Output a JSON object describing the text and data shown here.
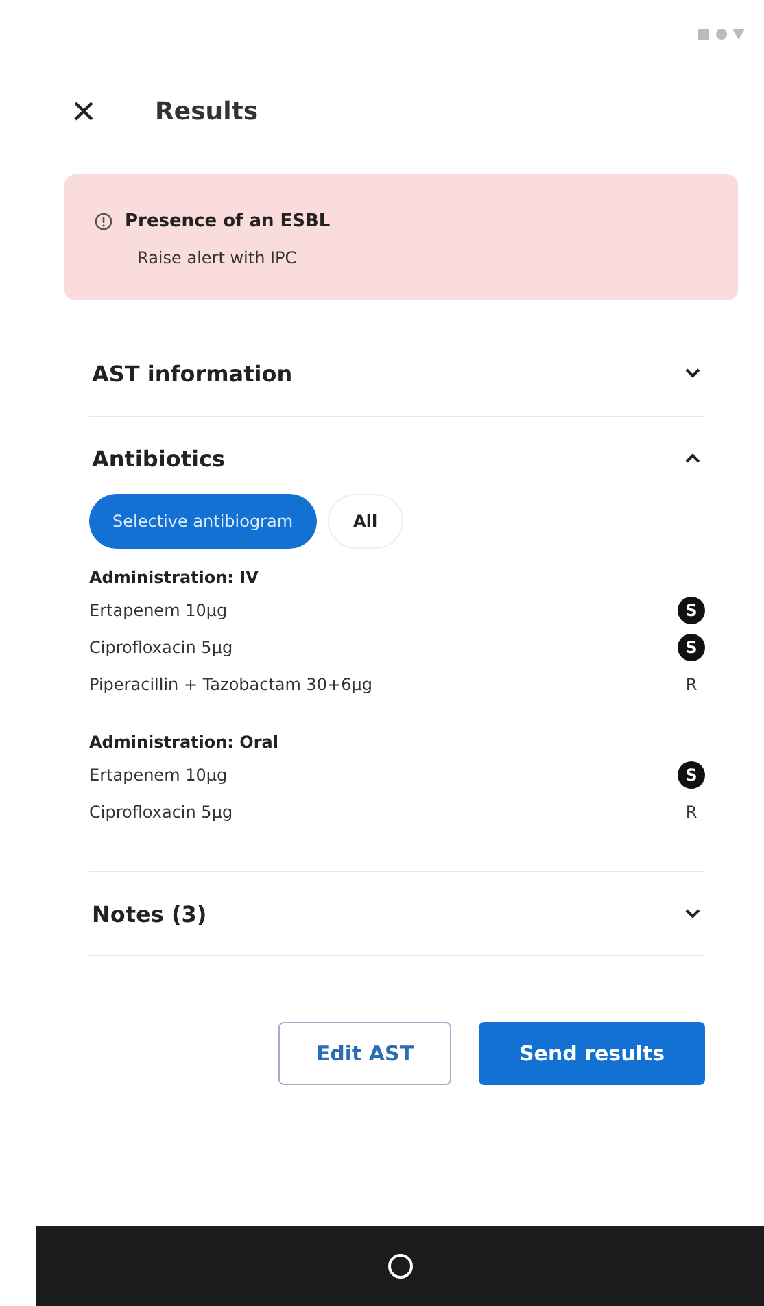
{
  "header": {
    "title": "Results"
  },
  "alert": {
    "title": "Presence of an ESBL",
    "message": "Raise alert with IPC"
  },
  "sections": [
    {
      "title": "AST information",
      "expanded": false
    },
    {
      "title": "Antibiotics",
      "expanded": true,
      "chips": [
        {
          "label": "Selective antibiogram",
          "selected": true
        },
        {
          "label": "All",
          "selected": false
        }
      ],
      "groups": [
        {
          "title": "Administration: IV",
          "rows": [
            {
              "name": "Ertapenem 10µg",
              "result": "S",
              "highlighted": true
            },
            {
              "name": "Ciprofloxacin 5µg",
              "result": "S",
              "highlighted": true
            },
            {
              "name": "Piperacillin + Tazobactam 30+6µg",
              "result": "R",
              "highlighted": false
            }
          ]
        },
        {
          "title": "Administration: Oral",
          "rows": [
            {
              "name": "Ertapenem 10µg",
              "result": "S",
              "highlighted": true
            },
            {
              "name": "Ciprofloxacin 5µg",
              "result": "R",
              "highlighted": false
            }
          ]
        }
      ]
    },
    {
      "title": "Notes (3)",
      "expanded": false
    }
  ],
  "buttons": [
    {
      "label": "Edit AST",
      "kind": "secondary"
    },
    {
      "label": "Send results",
      "kind": "primary"
    }
  ]
}
